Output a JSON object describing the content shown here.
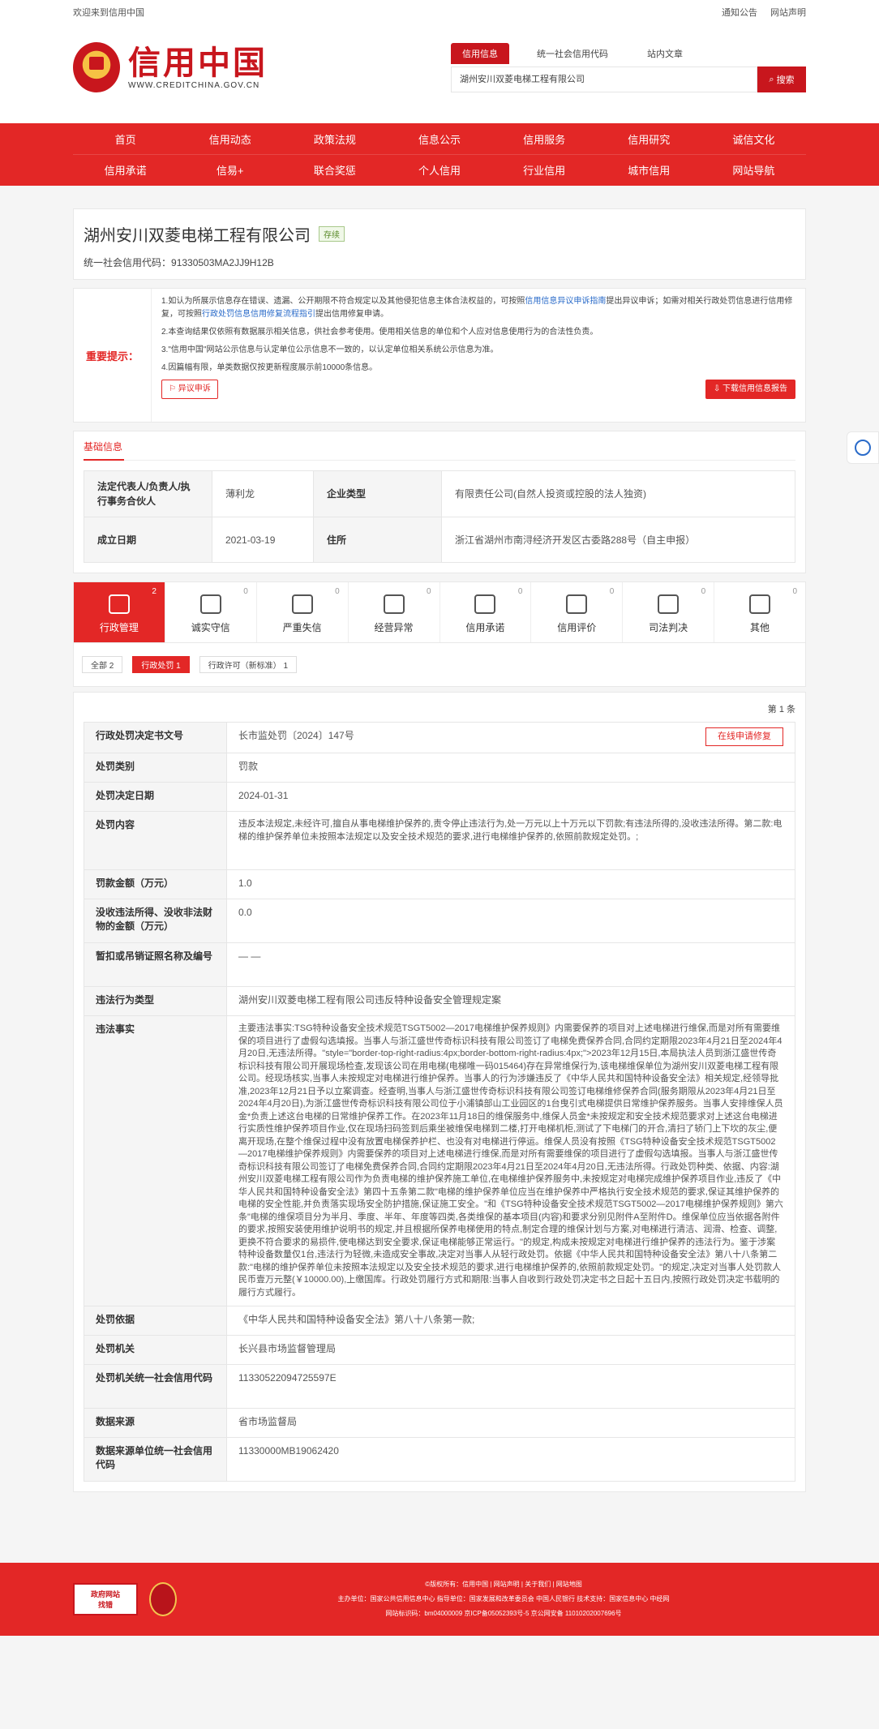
{
  "topbar": {
    "welcome": "欢迎来到信用中国",
    "links": [
      "通知公告",
      "网站声明"
    ]
  },
  "header": {
    "title": "信用中国",
    "url": "WWW.CREDITCHINA.GOV.CN"
  },
  "search": {
    "tabs": [
      "信用信息",
      "统一社会信用代码",
      "站内文章"
    ],
    "value": "湖州安川双菱电梯工程有限公司",
    "button": "搜索"
  },
  "nav": {
    "row1": [
      "首页",
      "信用动态",
      "政策法规",
      "信息公示",
      "信用服务",
      "信用研究",
      "诚信文化"
    ],
    "row2": [
      "信用承诺",
      "信易+",
      "联合奖惩",
      "个人信用",
      "行业信用",
      "城市信用",
      "网站导航"
    ]
  },
  "company": {
    "name": "湖州安川双菱电梯工程有限公司",
    "status": "存续",
    "code_label": "统一社会信用代码：",
    "code": "91330503MA2JJ9H12B"
  },
  "notice": {
    "label": "重要提示：",
    "p1a": "1.如认为所展示信息存在错误、遗漏、公开期限不符合规定以及其他侵犯信息主体合法权益的，可按照",
    "p1link": "信用信息异议申诉指南",
    "p1b": "提出异议申诉；如需对相关行政处罚信息进行信用修复，可按照",
    "p1link2": "行政处罚信息信用修复流程指引",
    "p1c": "提出信用修复申请。",
    "p2": "2.本查询结果仅依照有数据展示相关信息，供社会参考使用。使用相关信息的单位和个人应对信息使用行为的合法性负责。",
    "p3": "3.\"信用中国\"网站公示信息与认定单位公示信息不一致的，以认定单位相关系统公示信息为准。",
    "p4": "4.因篇幅有限，单类数据仅按更新程度展示前10000条信息。",
    "btn_objection": "异议申诉",
    "btn_download": "下载信用信息报告"
  },
  "basic": {
    "title": "基础信息",
    "rows": [
      [
        "法定代表人/负责人/执行事务合伙人",
        "薄利龙",
        "企业类型",
        "有限责任公司(自然人投资或控股的法人独资)"
      ],
      [
        "成立日期",
        "2021-03-19",
        "住所",
        "浙江省湖州市南浔经济开发区古委路288号（自主申报）"
      ]
    ]
  },
  "categories": [
    {
      "label": "行政管理",
      "count": "2"
    },
    {
      "label": "诚实守信",
      "count": "0"
    },
    {
      "label": "严重失信",
      "count": "0"
    },
    {
      "label": "经营异常",
      "count": "0"
    },
    {
      "label": "信用承诺",
      "count": "0"
    },
    {
      "label": "信用评价",
      "count": "0"
    },
    {
      "label": "司法判决",
      "count": "0"
    },
    {
      "label": "其他",
      "count": "0"
    }
  ],
  "filters": [
    "全部  2",
    "行政处罚  1",
    "行政许可（新标准）  1"
  ],
  "detail": {
    "page": "第 1 条",
    "repair_btn": "在线申请修复",
    "rows": [
      [
        "行政处罚决定书文号",
        "长市监处罚〔2024〕147号"
      ],
      [
        "处罚类别",
        "罚款"
      ],
      [
        "处罚决定日期",
        "2024-01-31"
      ],
      [
        "处罚内容",
        "违反本法规定,未经许可,擅自从事电梯维护保养的,责令停止违法行为,处一万元以上十万元以下罚款;有违法所得的,没收违法所得。第二款:电梯的维护保养单位未按照本法规定以及安全技术规范的要求,进行电梯维护保养的,依照前款规定处罚。;"
      ],
      [
        "罚款金额（万元）",
        "1.0"
      ],
      [
        "没收违法所得、没收非法财物的金额（万元）",
        "0.0"
      ],
      [
        "暂扣或吊销证照名称及编号",
        "— —"
      ],
      [
        "违法行为类型",
        "湖州安川双菱电梯工程有限公司违反特种设备安全管理规定案"
      ],
      [
        "违法事实",
        "主要违法事实:TSG特种设备安全技术规范TSGT5002—2017电梯维护保养规则》内需要保养的项目对上述电梯进行维保,而是对所有需要维保的项目进行了虚假勾选填报。当事人与浙江盛世传奇标识科技有限公司签订了电梯免费保养合同,合同约定期限2023年4月21日至2024年4月20日,无违法所得。\"style=\"border-top-right-radius:4px;border-bottom-right-radius:4px;\">2023年12月15日,本局执法人员到浙江盛世传奇标识科技有限公司开展现场检查,发现该公司在用电梯(电梯唯一码015464)存在异常维保行为,该电梯维保单位为湖州安川双菱电梯工程有限公司。经现场核实,当事人未按规定对电梯进行维护保养。当事人的行为涉嫌违反了《中华人民共和国特种设备安全法》相关规定,经领导批准,2023年12月21日予以立案调查。经查明,当事人与浙江盛世传奇标识科技有限公司签订电梯维修保养合同(服务期限从2023年4月21日至2024年4月20日),为浙江盛世传奇标识科技有限公司位于小浦镇部山工业园区的1台曳引式电梯提供日常维护保养服务。当事人安排维保人员金*负责上述这台电梯的日常维护保养工作。在2023年11月18日的维保服务中,维保人员金*未按规定和安全技术规范要求对上述这台电梯进行实质性维护保养项目作业,仅在现场扫码签到后乘坐被维保电梯到二楼,打开电梯机柜,测试了下电梯门的开合,清扫了轿门上下坎的灰尘,便离开现场,在整个维保过程中没有放置电梯保养护栏、也没有对电梯进行停运。维保人员没有按照《TSG特种设备安全技术规范TSGT5002—2017电梯维护保养规则》内需要保养的项目对上述电梯进行维保,而是对所有需要维保的项目进行了虚假勾选填报。当事人与浙江盛世传奇标识科技有限公司签订了电梯免费保养合同,合同约定期限2023年4月21日至2024年4月20日,无违法所得。行政处罚种类、依据、内容:湖州安川双菱电梯工程有限公司作为负责电梯的维护保养施工单位,在电梯维护保养服务中,未按规定对电梯完成维护保养项目作业,违反了《中华人民共和国特种设备安全法》第四十五条第二款\"电梯的维护保养单位应当在维护保养中严格执行安全技术规范的要求,保证其维护保养的电梯的安全性能,并负责落实现场安全防护措施,保证施工安全。\"和《TSG特种设备安全技术规范TSGT5002—2017电梯维护保养规则》第六条\"电梯的维保项目分为半月、季度、半年、年度等四类,各类维保的基本项目(内容)和要求分别见附件A至附件D。维保单位应当依据各附件的要求,按照安装使用维护说明书的规定,并且根据所保养电梯使用的特点,制定合理的维保计划与方案,对电梯进行清洁、润滑、检查、调整,更换不符合要求的易损件,使电梯达到安全要求,保证电梯能够正常运行。\"的规定,构成未按规定对电梯进行维护保养的违法行为。鉴于涉案特种设备数量仅1台,违法行为轻微,未造成安全事故,决定对当事人从轻行政处罚。依据《中华人民共和国特种设备安全法》第八十八条第二款:\"电梯的维护保养单位未按照本法规定以及安全技术规范的要求,进行电梯维护保养的,依照前款规定处罚。\"的规定,决定对当事人处罚款人民币壹万元整(￥10000.00),上缴国库。行政处罚履行方式和期限:当事人自收到行政处罚决定书之日起十五日内,按照行政处罚决定书载明的履行方式履行。"
      ],
      [
        "处罚依据",
        "《中华人民共和国特种设备安全法》第八十八条第一款;"
      ],
      [
        "处罚机关",
        "长兴县市场监督管理局"
      ],
      [
        "处罚机关统一社会信用代码",
        "11330522094725597E"
      ],
      [
        "数据来源",
        "省市场监督局"
      ],
      [
        "数据来源单位统一社会信用代码",
        "11330000MB19062420"
      ]
    ]
  },
  "footer": {
    "line1": "©版权所有：信用中国 | 网站声明 | 关于我们 | 网站地图",
    "line2": "主办单位：国家公共信用信息中心  指导单位：国家发展和改革委员会 中国人民银行  技术支持：国家信息中心 中经网",
    "line3": "网站标识码：bm04000009  京ICP备05052393号-5  京公网安备 11010202007696号",
    "badge1a": "政府网站",
    "badge1b": "找错"
  }
}
